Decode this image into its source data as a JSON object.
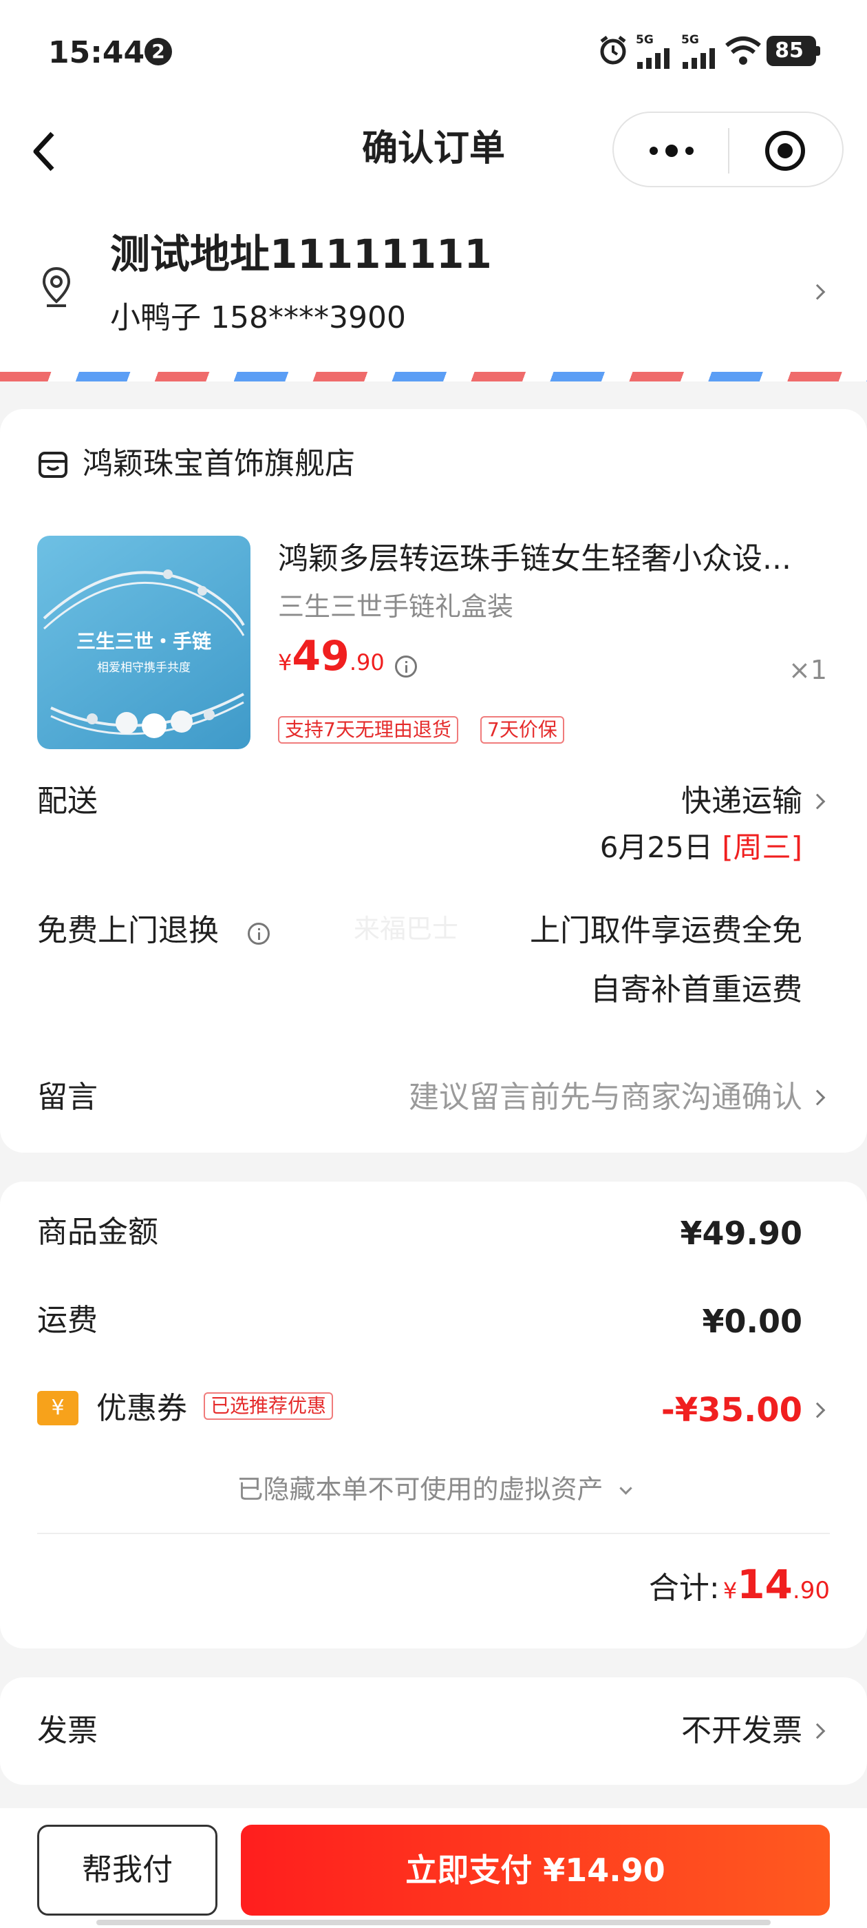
{
  "status_bar": {
    "time": "15:44",
    "notification_count": "2",
    "signal_1": "5G",
    "signal_2": "5G",
    "battery": "85"
  },
  "nav": {
    "title": "确认订单",
    "back_icon": "chevron-left-icon",
    "more_icon": "more-dots-icon",
    "capsule_icon": "record-circle-icon"
  },
  "address": {
    "title": "测试地址11111111",
    "contact": "小鸭子 158****3900",
    "location_icon": "location-pin-icon"
  },
  "store": {
    "name": "鸿颖珠宝首饰旗舰店",
    "store_icon": "shop-icon",
    "product": {
      "image_title": "三生三世・手链",
      "image_subtitle": "相爱相守携手共度",
      "title": "鸿颖多层转运珠手链女生轻奢小众设...",
      "spec": "三生三世手链礼盒装",
      "price_symbol": "¥",
      "price_int": "49",
      "price_dec": ".90",
      "quantity": "×1",
      "tags": [
        "支持7天无理由退货",
        "7天价保"
      ]
    },
    "delivery": {
      "label": "配送",
      "method": "快递运输",
      "date": "6月25日",
      "weekday": "[周三]"
    },
    "return": {
      "label": "免费上门退换",
      "watermark": "来福巴士",
      "line1": "上门取件享运费全免",
      "line2": "自寄补首重运费"
    },
    "message": {
      "label": "留言",
      "placeholder": "建议留言前先与商家沟通确认"
    }
  },
  "summary": {
    "goods_label": "商品金额",
    "goods_value": "¥49.90",
    "shipping_label": "运费",
    "shipping_value": "¥0.00",
    "coupon_icon": "¥",
    "coupon_label": "优惠券",
    "coupon_tag": "已选推荐优惠",
    "coupon_value": "-¥35.00",
    "hidden_assets": "已隐藏本单不可使用的虚拟资产",
    "total_label": "合计:",
    "total_symbol": "¥",
    "total_int": "14",
    "total_dec": ".90"
  },
  "invoice": {
    "label": "发票",
    "value": "不开发票"
  },
  "footer": {
    "help_pay": "帮我付",
    "pay_now": "立即支付 ¥14.90"
  },
  "colors": {
    "accent_red": "#f01f1f",
    "pay_gradient_start": "#ff1e1e",
    "pay_gradient_end": "#ff5a1f",
    "stripe_red": "#ef6b6b",
    "stripe_blue": "#5b9ef5",
    "coupon_icon_bg": "#f7a21b"
  }
}
